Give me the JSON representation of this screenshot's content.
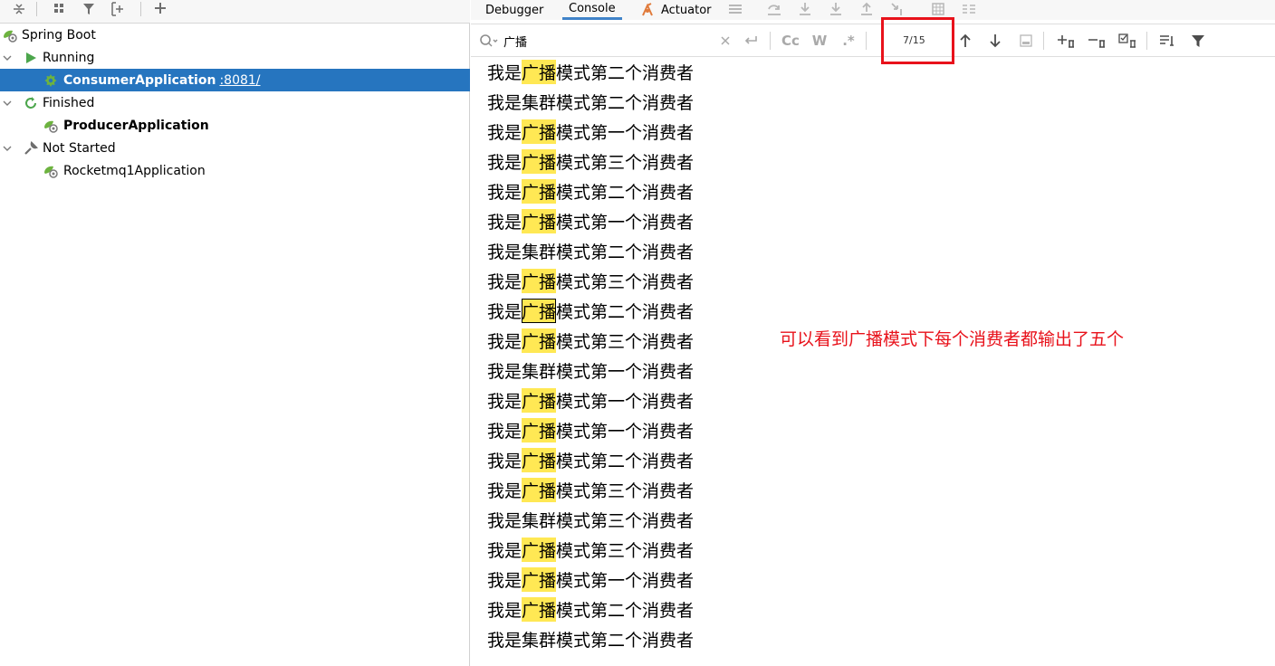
{
  "run_dashboard": {
    "groups": [
      {
        "label": "Spring Boot"
      },
      {
        "label": "Running"
      },
      {
        "label": "ConsumerApplication",
        "port": ":8081/"
      },
      {
        "label": "Finished"
      },
      {
        "label": "ProducerApplication"
      },
      {
        "label": "Not Started"
      },
      {
        "label": "Rocketmq1Application"
      }
    ]
  },
  "tabs": {
    "debugger": "Debugger",
    "console": "Console",
    "actuator": "Actuator"
  },
  "search": {
    "query": "广播",
    "match_counter": "7/15",
    "case_toggle": "Cc",
    "word_toggle": "W",
    "regex_toggle": ".*"
  },
  "console": {
    "lines": [
      {
        "pre": "我是",
        "match": "广播",
        "post": "模式第二个消费者"
      },
      {
        "pre": "我是",
        "match": "",
        "post": "集群模式第二个消费者"
      },
      {
        "pre": "我是",
        "match": "广播",
        "post": "模式第一个消费者"
      },
      {
        "pre": "我是",
        "match": "广播",
        "post": "模式第三个消费者"
      },
      {
        "pre": "我是",
        "match": "广播",
        "post": "模式第二个消费者"
      },
      {
        "pre": "我是",
        "match": "广播",
        "post": "模式第一个消费者"
      },
      {
        "pre": "我是",
        "match": "",
        "post": "集群模式第二个消费者"
      },
      {
        "pre": "我是",
        "match": "广播",
        "post": "模式第三个消费者"
      },
      {
        "pre": "我是",
        "match": "广播",
        "post": "模式第二个消费者"
      },
      {
        "pre": "我是",
        "match": "广播",
        "post": "模式第三个消费者"
      },
      {
        "pre": "我是",
        "match": "",
        "post": "集群模式第一个消费者"
      },
      {
        "pre": "我是",
        "match": "广播",
        "post": "模式第一个消费者"
      },
      {
        "pre": "我是",
        "match": "广播",
        "post": "模式第一个消费者"
      },
      {
        "pre": "我是",
        "match": "广播",
        "post": "模式第二个消费者"
      },
      {
        "pre": "我是",
        "match": "广播",
        "post": "模式第三个消费者"
      },
      {
        "pre": "我是",
        "match": "",
        "post": "集群模式第三个消费者"
      },
      {
        "pre": "我是",
        "match": "广播",
        "post": "模式第三个消费者"
      },
      {
        "pre": "我是",
        "match": "广播",
        "post": "模式第一个消费者"
      },
      {
        "pre": "我是",
        "match": "广播",
        "post": "模式第二个消费者"
      },
      {
        "pre": "我是",
        "match": "",
        "post": "集群模式第二个消费者"
      }
    ],
    "current_match_line": 8
  },
  "annotation": "可以看到广播模式下每个消费者都输出了五个",
  "colors": {
    "selection": "#2675bf",
    "highlight": "#ffe854",
    "annotation": "#e8121b",
    "run_green": "#4ca64c",
    "springboot_green": "#6db33f"
  }
}
